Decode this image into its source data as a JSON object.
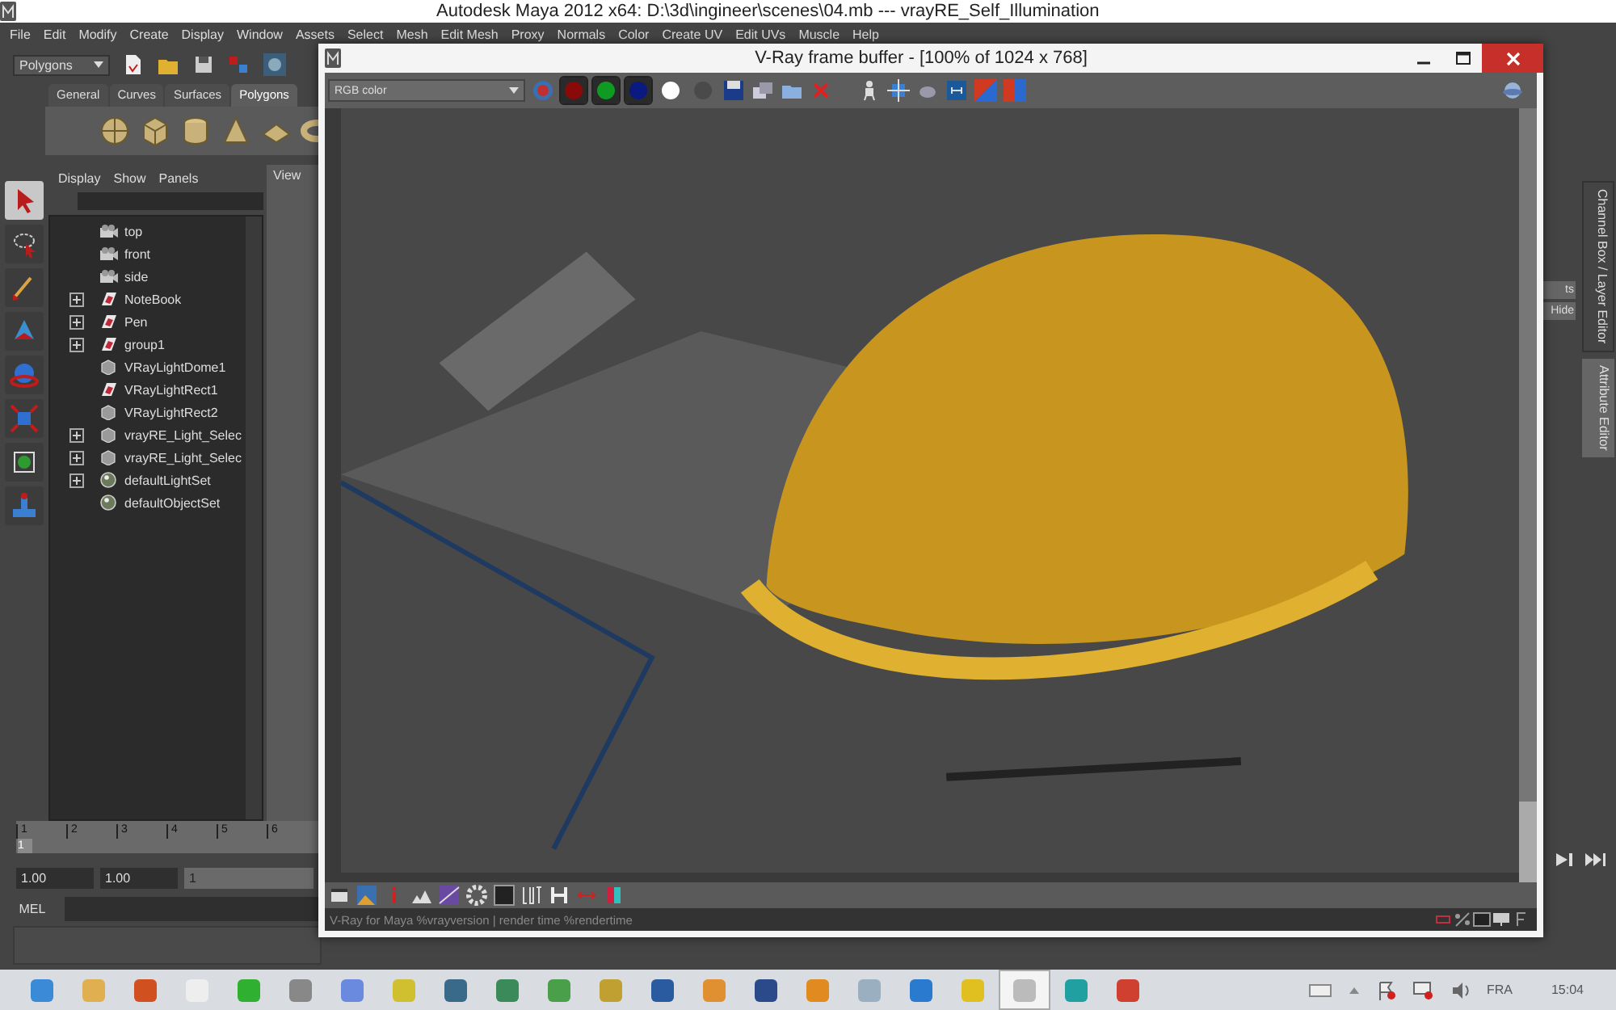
{
  "maya": {
    "title": "Autodesk Maya 2012 x64: D:\\3d\\ingineer\\scenes\\04.mb   ---   vrayRE_Self_Illumination",
    "menu": [
      "File",
      "Edit",
      "Modify",
      "Create",
      "Display",
      "Window",
      "Assets",
      "Select",
      "Mesh",
      "Edit Mesh",
      "Proxy",
      "Normals",
      "Color",
      "Create UV",
      "Edit UVs",
      "Muscle",
      "Help"
    ],
    "mode": "Polygons",
    "shelf_tabs": [
      {
        "label": "General",
        "selected": false
      },
      {
        "label": "Curves",
        "selected": false
      },
      {
        "label": "Surfaces",
        "selected": false
      },
      {
        "label": "Polygons",
        "selected": true
      }
    ],
    "outliner": {
      "menu": [
        "Display",
        "Show",
        "Panels"
      ],
      "items": [
        {
          "label": "top",
          "kind": "camera",
          "collapsible": false
        },
        {
          "label": "front",
          "kind": "camera",
          "collapsible": false
        },
        {
          "label": "side",
          "kind": "camera",
          "collapsible": false
        },
        {
          "label": "NoteBook",
          "kind": "transform",
          "collapsible": true
        },
        {
          "label": "Pen",
          "kind": "transform",
          "collapsible": true
        },
        {
          "label": "group1",
          "kind": "transform",
          "collapsible": true
        },
        {
          "label": "VRayLightDome1",
          "kind": "node",
          "collapsible": false
        },
        {
          "label": "VRayLightRect1",
          "kind": "transform",
          "collapsible": false
        },
        {
          "label": "VRayLightRect2",
          "kind": "node",
          "collapsible": false
        },
        {
          "label": "vrayRE_Light_Selec",
          "kind": "node",
          "collapsible": true
        },
        {
          "label": "vrayRE_Light_Selec",
          "kind": "node",
          "collapsible": true
        },
        {
          "label": "defaultLightSet",
          "kind": "set",
          "collapsible": true
        },
        {
          "label": "defaultObjectSet",
          "kind": "set",
          "collapsible": false
        }
      ]
    },
    "view_menu": "View",
    "side_tabs": [
      {
        "label": "Channel Box / Layer Editor",
        "selected": true
      },
      {
        "label": "Attribute Editor",
        "selected": false
      }
    ],
    "side_buttons": [
      "ts",
      "Hide"
    ],
    "timeline": {
      "ticks": [
        "1",
        "2",
        "3",
        "4",
        "5",
        "6"
      ],
      "current": "1"
    },
    "range": {
      "start": "1.00",
      "playback_start": "1.00",
      "current": "1"
    },
    "command_label": "MEL"
  },
  "vray": {
    "title": "V-Ray frame buffer - [100% of 1024 x 768]",
    "channel_menu": "RGB color",
    "channels": [
      {
        "color": "#8a0a0a",
        "selected": true
      },
      {
        "color": "#0f9a22",
        "selected": true
      },
      {
        "color": "#0b1a80",
        "selected": true
      },
      {
        "color": "#ffffff",
        "selected": false
      },
      {
        "color": "#4a4a4a",
        "selected": false
      }
    ],
    "status": "V-Ray for Maya %vrayversion | render time %rendertime"
  },
  "taskbar": {
    "apps": [
      {
        "selected": false
      },
      {
        "selected": false
      },
      {
        "selected": false
      },
      {
        "selected": false
      },
      {
        "selected": false
      },
      {
        "selected": false
      },
      {
        "selected": false
      },
      {
        "selected": false
      },
      {
        "selected": false
      },
      {
        "selected": false
      },
      {
        "selected": false
      },
      {
        "selected": false
      },
      {
        "selected": false
      },
      {
        "selected": false
      },
      {
        "selected": false
      },
      {
        "selected": false
      },
      {
        "selected": false
      },
      {
        "selected": false
      },
      {
        "selected": false
      },
      {
        "selected": true
      },
      {
        "selected": false
      },
      {
        "selected": false
      }
    ],
    "language": "FRA",
    "time": "15:04"
  }
}
